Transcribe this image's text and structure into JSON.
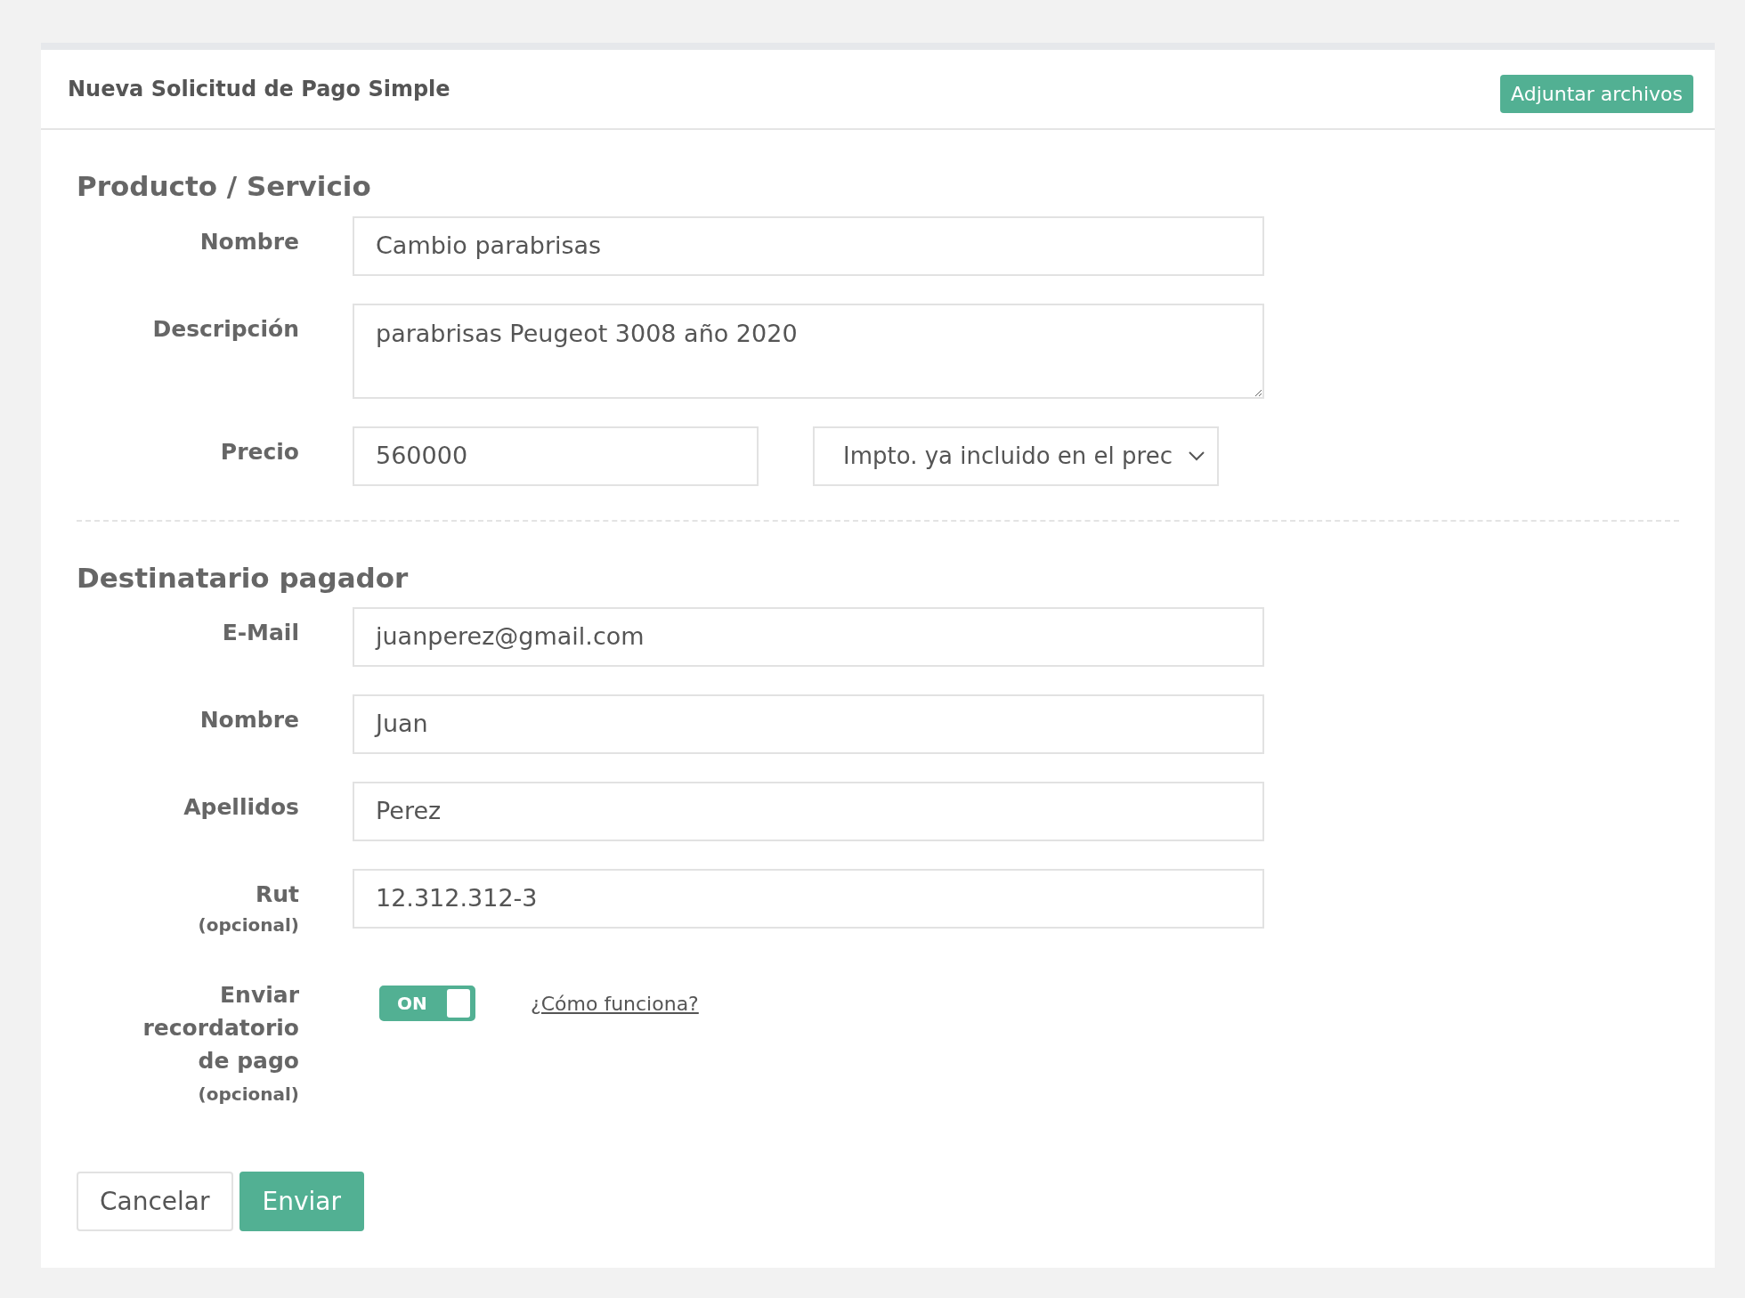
{
  "header": {
    "title": "Nueva Solicitud de Pago Simple",
    "attach_button": "Adjuntar archivos"
  },
  "sections": [
    {
      "heading": "Producto / Servicio",
      "fields": [
        {
          "kind": "input",
          "label": "Nombre",
          "value": "Cambio parabrisas"
        },
        {
          "kind": "textarea",
          "label": "Descripción",
          "value": "parabrisas Peugeot 3008 año 2020"
        },
        {
          "kind": "price",
          "label": "Precio",
          "value": "560000",
          "select": "Impto. ya incluido en el prec"
        }
      ]
    },
    {
      "heading": "Destinatario pagador",
      "fields": [
        {
          "kind": "input",
          "label": "E-Mail",
          "value": "juanperez@gmail.com"
        },
        {
          "kind": "input",
          "label": "Nombre",
          "value": "Juan"
        },
        {
          "kind": "input",
          "label": "Apellidos",
          "value": "Perez"
        },
        {
          "kind": "input",
          "label": "Rut",
          "note": "(opcional)",
          "value": "12.312.312-3"
        },
        {
          "kind": "toggle",
          "label_lines": [
            "Enviar",
            "recordatorio",
            "de pago"
          ],
          "note": "(opcional)",
          "on": true,
          "toggle_text": "ON",
          "link": "¿Cómo funciona?"
        }
      ]
    }
  ],
  "buttons": [
    {
      "label": "Cancelar",
      "kind": "secondary"
    },
    {
      "label": "Enviar",
      "kind": "primary"
    }
  ]
}
